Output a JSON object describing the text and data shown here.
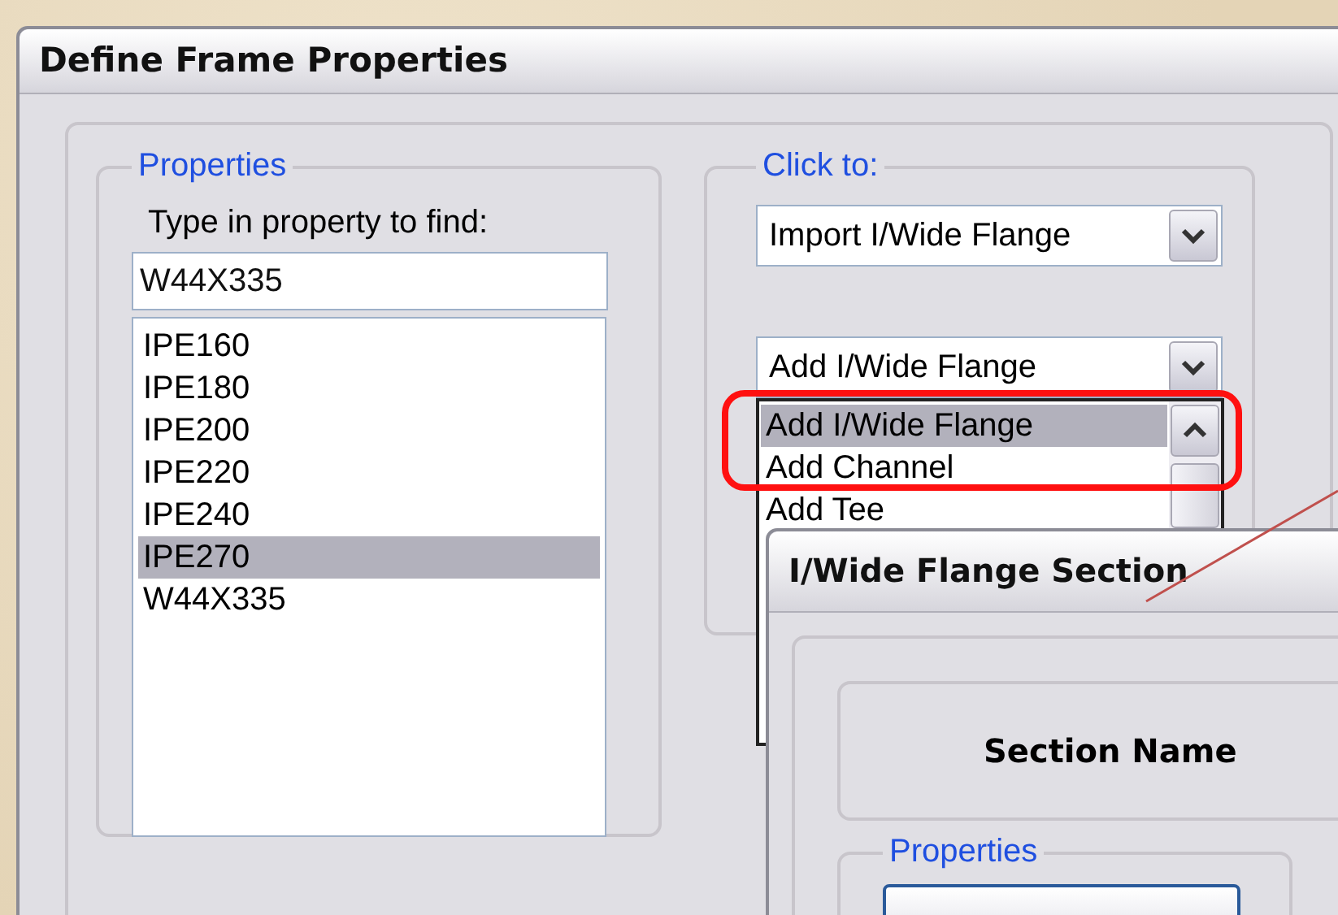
{
  "main_window": {
    "title": "Define Frame Properties",
    "properties_group": {
      "label": "Properties",
      "search_label": "Type in property to find:",
      "search_value": "W44X335",
      "items": [
        {
          "label": "IPE160",
          "selected": false
        },
        {
          "label": "IPE180",
          "selected": false
        },
        {
          "label": "IPE200",
          "selected": false
        },
        {
          "label": "IPE220",
          "selected": false
        },
        {
          "label": "IPE240",
          "selected": false
        },
        {
          "label": "IPE270",
          "selected": true
        },
        {
          "label": "W44X335",
          "selected": false
        }
      ]
    },
    "click_to_group": {
      "label": "Click to:",
      "import_combo": {
        "value": "Import I/Wide Flange"
      },
      "add_combo": {
        "value": "Add I/Wide Flange",
        "expanded": true,
        "options": [
          {
            "label": "Add I/Wide Flange",
            "selected": true
          },
          {
            "label": "Add Channel",
            "selected": false
          },
          {
            "label": "Add Tee",
            "selected": false
          }
        ]
      }
    }
  },
  "section_window": {
    "title": "I/Wide Flange Section",
    "section_name_label": "Section Name",
    "properties_group": {
      "label": "Properties"
    }
  }
}
